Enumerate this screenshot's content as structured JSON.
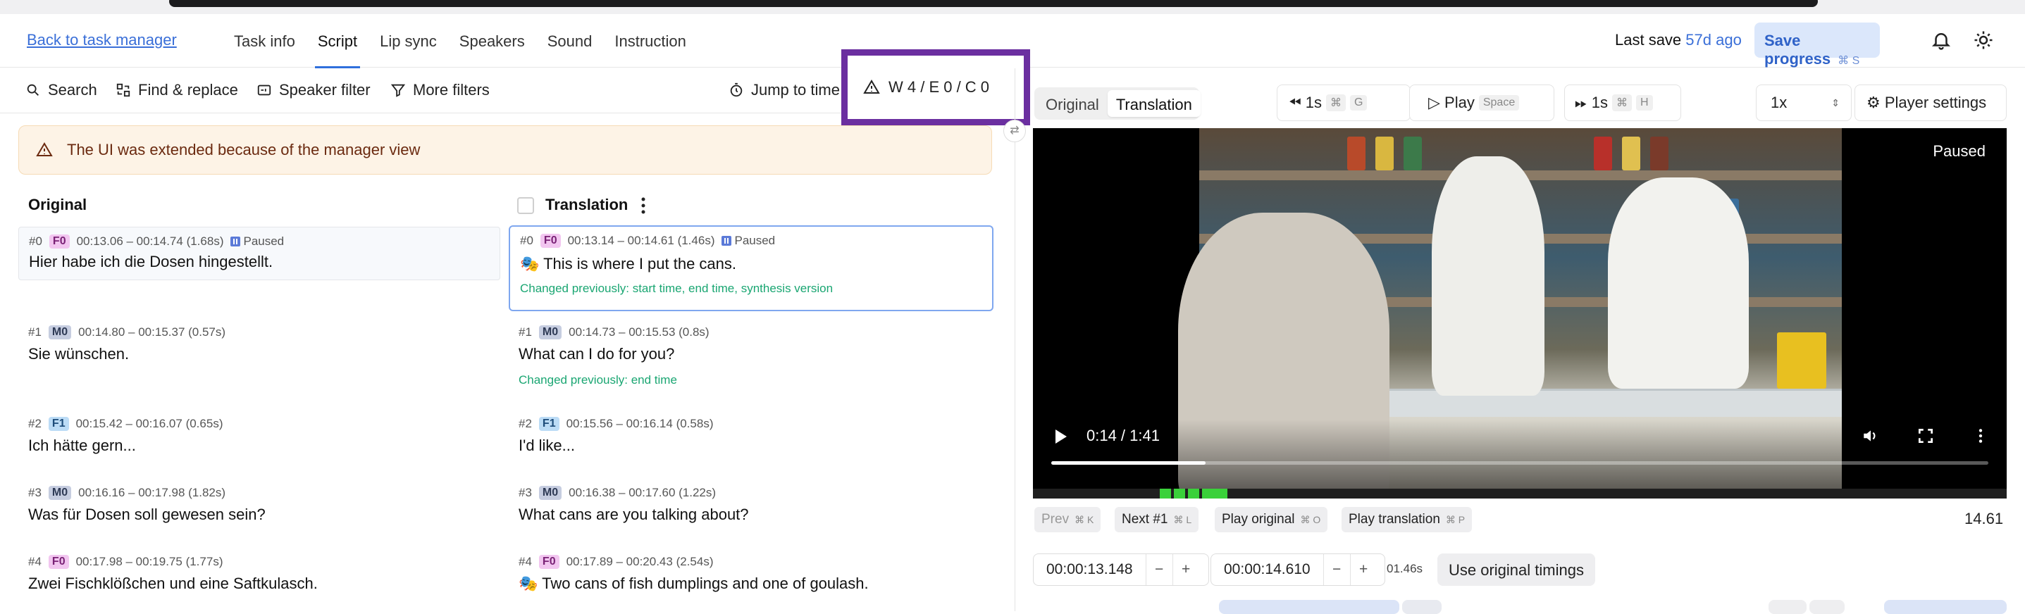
{
  "header": {
    "back_link": "Back to task manager",
    "tabs": [
      "Task info",
      "Script",
      "Lip sync",
      "Speakers",
      "Sound",
      "Instruction"
    ],
    "active_tab": "Script",
    "last_save_label": "Last save",
    "last_save_value": "57d ago",
    "save_button": "Save progress",
    "save_shortcut": "⌘ S"
  },
  "toolbar": {
    "search": "Search",
    "find_replace": "Find & replace",
    "speaker_filter": "Speaker filter",
    "more_filters": "More filters",
    "jump_to_time": "Jump to time",
    "wec": "W 4 / E 0 / C 0"
  },
  "banner": "The UI was extended because of the manager view",
  "columns": {
    "original": "Original",
    "translation": "Translation"
  },
  "original_segments": [
    {
      "id": "#0",
      "speaker": "F0",
      "time": "00:13.06 – 00:14.74 (1.68s)",
      "paused": "Paused",
      "text": "Hier habe ich die Dosen hingestellt."
    },
    {
      "id": "#1",
      "speaker": "M0",
      "time": "00:14.80 – 00:15.37 (0.57s)",
      "text": "Sie wünschen."
    },
    {
      "id": "#2",
      "speaker": "F1",
      "time": "00:15.42 – 00:16.07 (0.65s)",
      "text": "Ich hätte gern..."
    },
    {
      "id": "#3",
      "speaker": "M0",
      "time": "00:16.16 – 00:17.98 (1.82s)",
      "text": "Was für Dosen soll gewesen sein?"
    },
    {
      "id": "#4",
      "speaker": "F0",
      "time": "00:17.98 – 00:19.75 (1.77s)",
      "text": "Zwei Fischklößchen und eine Saftkulasch."
    }
  ],
  "translation_segments": [
    {
      "id": "#0",
      "speaker": "F0",
      "time": "00:13.14 – 00:14.61 (1.46s)",
      "paused": "Paused",
      "text": "🎭 This is where I put the cans.",
      "changed": "Changed previously: start time, end time, synthesis version"
    },
    {
      "id": "#1",
      "speaker": "M0",
      "time": "00:14.73 – 00:15.53 (0.8s)",
      "text": "What can I do for you?",
      "changed": "Changed previously: end time"
    },
    {
      "id": "#2",
      "speaker": "F1",
      "time": "00:15.56 – 00:16.14 (0.58s)",
      "text": "I'd like..."
    },
    {
      "id": "#3",
      "speaker": "M0",
      "time": "00:16.38 – 00:17.60 (1.22s)",
      "text": "What cans are you talking about?"
    },
    {
      "id": "#4",
      "speaker": "F0",
      "time": "00:17.89 – 00:20.43 (2.54s)",
      "text": "🎭 Two cans of fish dumplings and one of goulash."
    }
  ],
  "player": {
    "view_original": "Original",
    "view_translation": "Translation",
    "back_label": "1s",
    "back_keys": [
      "⌘",
      "G"
    ],
    "play_label": "Play",
    "play_key": "Space",
    "fwd_label": "1s",
    "fwd_keys": [
      "⌘",
      "H"
    ],
    "speed": "1x",
    "settings": "Player settings",
    "paused_overlay": "Paused",
    "video_time": "0:14 / 1:41",
    "progress": 0.165
  },
  "controls": {
    "prev": "Prev",
    "prev_key": "⌘ K",
    "next": "Next #1",
    "next_key": "⌘ L",
    "play_original": "Play original",
    "play_original_key": "⌘ O",
    "play_translation": "Play translation",
    "play_translation_key": "⌘ P",
    "position": "14.61",
    "start_time": "00:00:13.148",
    "end_time": "00:00:14.610",
    "duration": "01.46s",
    "use_original_timings": "Use original timings",
    "minus": "−",
    "plus": "+"
  },
  "colors": {
    "accent": "#2f6fdc",
    "highlight_border": "#6b2fa0",
    "changed": "#1aa672"
  }
}
